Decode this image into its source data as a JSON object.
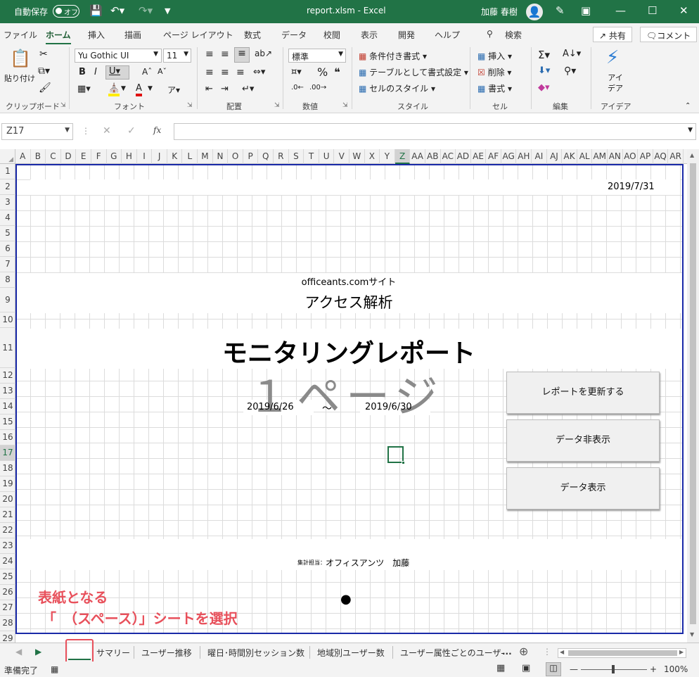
{
  "titlebar": {
    "autosave_label": "自動保存",
    "toggle_state": "オフ",
    "document_title": "report.xlsm  -  Excel",
    "user_name": "加藤 春樹"
  },
  "menu": {
    "tabs": [
      "ファイル",
      "ホーム",
      "挿入",
      "描画",
      "ページ レイアウト",
      "数式",
      "データ",
      "校閲",
      "表示",
      "開発",
      "ヘルプ"
    ],
    "active_tab": "ホーム",
    "search_label": "検索",
    "share_label": "共有",
    "comment_label": "コメント"
  },
  "ribbon": {
    "clipboard": {
      "paste_label": "貼り付け",
      "group_label": "クリップボード"
    },
    "font": {
      "font_name": "Yu Gothic UI",
      "font_size": "11",
      "group_label": "フォント"
    },
    "alignment": {
      "group_label": "配置"
    },
    "number": {
      "format_value": "標準",
      "group_label": "数値"
    },
    "styles": {
      "conditional_label": "条件付き書式",
      "table_label": "テーブルとして書式設定",
      "cellstyle_label": "セルのスタイル",
      "group_label": "スタイル"
    },
    "cells": {
      "insert_label": "挿入",
      "delete_label": "削除",
      "format_label": "書式",
      "group_label": "セル"
    },
    "editing": {
      "group_label": "編集"
    },
    "ideas": {
      "button_label": "アイ\nデア",
      "group_label": "アイデア"
    }
  },
  "formula_bar": {
    "name_box": "Z17",
    "fx_label": "fx",
    "formula_value": ""
  },
  "grid": {
    "columns": [
      "A",
      "B",
      "C",
      "D",
      "E",
      "F",
      "G",
      "H",
      "I",
      "J",
      "K",
      "L",
      "M",
      "N",
      "O",
      "P",
      "Q",
      "R",
      "S",
      "T",
      "U",
      "V",
      "W",
      "X",
      "Y",
      "Z",
      "AA",
      "AB",
      "AC",
      "AD",
      "AE",
      "AF",
      "AG",
      "AH",
      "AI",
      "AJ",
      "AK",
      "AL",
      "AM",
      "AN",
      "AO",
      "AP",
      "AQ",
      "AR"
    ],
    "selected_column": "Z",
    "rows": [
      "1",
      "2",
      "3",
      "4",
      "5",
      "6",
      "7",
      "8",
      "9",
      "10",
      "11",
      "12",
      "13",
      "14",
      "15",
      "16",
      "17",
      "18",
      "19",
      "20",
      "21",
      "22",
      "23",
      "24",
      "25",
      "26",
      "27",
      "28",
      "29"
    ],
    "selected_row": "17",
    "selected_cell": "Z17"
  },
  "report": {
    "date": "2019/7/31",
    "site": "officeants.comサイト",
    "subtitle": "アクセス解析",
    "title": "モニタリングレポート",
    "page_watermark": "１ページ",
    "period_start": "2019/6/26",
    "period_tilde": "～",
    "period_end": "2019/6/30",
    "author_label": "集計担当：",
    "author_name": "オフィスアンツ　加藤"
  },
  "buttons": {
    "refresh": "レポートを更新する",
    "hide_data": "データ非表示",
    "show_data": "データ表示"
  },
  "annotation": {
    "line1": "表紙となる",
    "line2": "「　（スペース）」シートを選択"
  },
  "sheet_tabs": {
    "tabs": [
      "",
      "サマリー",
      "ユーザー推移",
      "曜日･時間別セッション数",
      "地域別ユーザー数",
      "ユーザー属性ごとのユーザ-"
    ],
    "active_index": 0,
    "more_label": "..."
  },
  "status": {
    "ready": "準備完了",
    "zoom": "100%"
  },
  "colors": {
    "excel_green": "#217346",
    "print_border": "#1a2aa8",
    "annotation_red": "#e8505b"
  }
}
